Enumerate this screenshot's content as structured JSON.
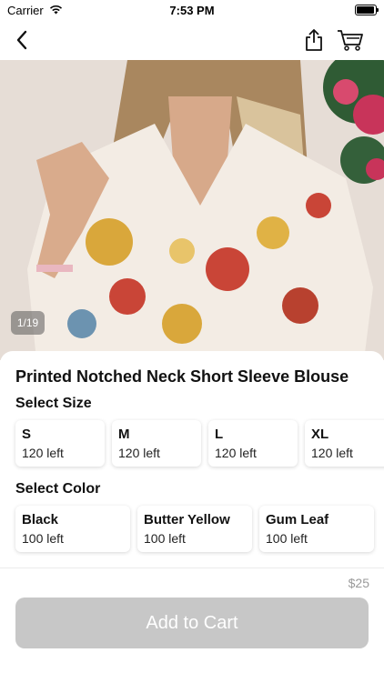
{
  "status_bar": {
    "carrier": "Carrier",
    "time": "7:53 PM"
  },
  "nav": {
    "back_icon": "chevron-left-icon",
    "share_icon": "share-icon",
    "cart_icon": "cart-icon"
  },
  "gallery": {
    "counter": "1/19"
  },
  "product": {
    "title": "Printed Notched Neck Short Sleeve Blouse",
    "size_label": "Select Size",
    "sizes": [
      {
        "name": "S",
        "stock": "120 left"
      },
      {
        "name": "M",
        "stock": "120 left"
      },
      {
        "name": "L",
        "stock": "120 left"
      },
      {
        "name": "XL",
        "stock": "120 left"
      }
    ],
    "color_label": "Select Color",
    "colors": [
      {
        "name": "Black",
        "stock": "100 left"
      },
      {
        "name": "Butter Yellow",
        "stock": "100 left"
      },
      {
        "name": "Gum Leaf",
        "stock": "100 left"
      }
    ]
  },
  "footer": {
    "price": "$25",
    "add_to_cart_label": "Add to Cart",
    "button_color": "#c7c7c7"
  }
}
